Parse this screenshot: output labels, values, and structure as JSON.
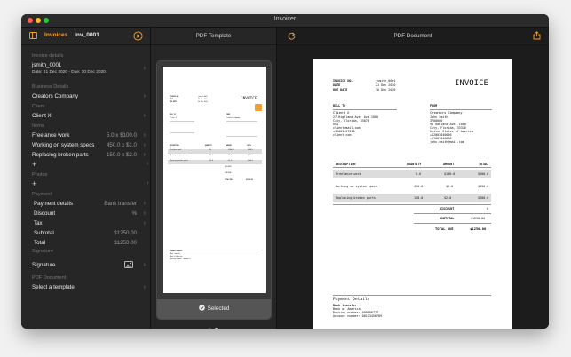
{
  "window": {
    "title": "Invoicer"
  },
  "toolbar": {
    "tab": "Invoices",
    "doc_name": "inv_0001"
  },
  "sidebar": {
    "invoice_details_header": "Invoice details",
    "client_summary": "jsmith_0001",
    "dates_summary": "Date: 21 Dec 2020 - Due: 30 Dec 2020",
    "business_details_header": "Business Details",
    "business_name": "Creators Company",
    "client_header": "Client",
    "client_name": "Client X",
    "items_header": "Items",
    "items": [
      {
        "name": "Freelance work",
        "value": "5.0 x $100.0"
      },
      {
        "name": "Working on system specs",
        "value": "450.0 x $1.0"
      },
      {
        "name": "Replacing broken parts",
        "value": "150.0 x $2.0"
      }
    ],
    "photos_header": "Photos",
    "payment_header": "Payment",
    "payment_details_label": "Payment details",
    "payment_details_value": "Bank transfer",
    "discount_label": "Discount",
    "discount_value": "%",
    "tax_label": "Tax",
    "subtotal_label": "Subtotal",
    "subtotal_value": "$1250.00",
    "total_label": "Total",
    "total_value": "$1250.00",
    "signature_header": "Signature",
    "signature_label": "Signature",
    "pdf_document_header": "PDF Document",
    "select_template_label": "Select a template"
  },
  "middle": {
    "header": "PDF Template",
    "selected_label": "Selected"
  },
  "right": {
    "header": "PDF Document"
  },
  "invoice": {
    "title": "INVOICE",
    "meta": [
      {
        "label": "INVOICE NO.",
        "value": "jsmith_0001"
      },
      {
        "label": "DATE",
        "value": "21 Dec 2020"
      },
      {
        "label": "DUE DATE",
        "value": "30 Dec 2020"
      }
    ],
    "bill_to_header": "BILL TO",
    "bill_to_lines": [
      "Client X",
      "27 Highland Ave, Ave 1000",
      "City, Florida, 33070",
      "USA",
      "client@mail.com",
      "+12003457216",
      "client.com"
    ],
    "from_header": "FROM",
    "from_lines": [
      "Creators Company",
      "John Smith",
      "3700000",
      "98 Oakland Ave, 1000",
      "City, Florida, 33370",
      "United States of America",
      "+12003040006",
      "+12003040006",
      "john.smith@mail.com"
    ],
    "columns": [
      "DESCRIPTION",
      "QUANTITY",
      "AMOUNT",
      "TOTAL"
    ],
    "rows": [
      {
        "desc": "Freelance work",
        "qty": "5.0",
        "amount": "$100.0",
        "total": "$500.0"
      },
      {
        "desc": "Working on system specs",
        "qty": "450.0",
        "amount": "$1.0",
        "total": "$450.0"
      },
      {
        "desc": "Replacing broken parts",
        "qty": "150.0",
        "amount": "$2.0",
        "total": "$300.0"
      }
    ],
    "discount_label": "DISCOUNT",
    "discount_value": "0",
    "subtotal_label": "SUBTOTAL",
    "subtotal_value": "$1250.00",
    "total_due_label": "TOTAL DUE",
    "total_due_value": "$1250.00",
    "payment_header": "Payment Details",
    "payment_lines": [
      "Bank transfer",
      "Bank of America",
      "Routing number: 999886777",
      "Account number: 00123456789"
    ]
  },
  "colors": {
    "accent": "#f0a030",
    "window_bg": "#1e1e1e",
    "sidebar_bg": "#262626"
  }
}
